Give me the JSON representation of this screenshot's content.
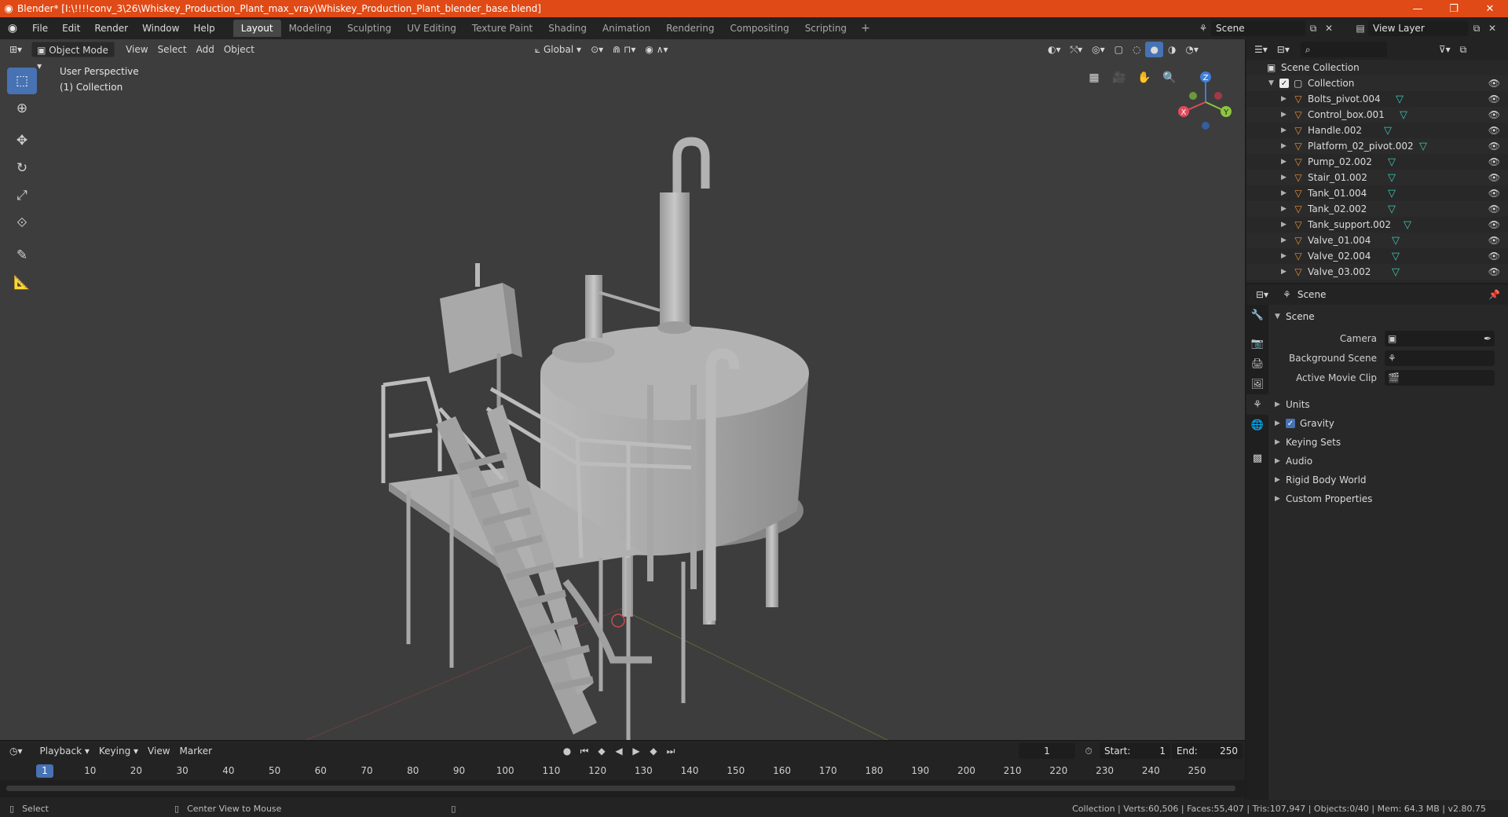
{
  "window": {
    "title": "Blender* [I:\\!!!!conv_3\\26\\Whiskey_Production_Plant_max_vray\\Whiskey_Production_Plant_blender_base.blend]",
    "logo": "blender-logo"
  },
  "menu": [
    "File",
    "Edit",
    "Render",
    "Window",
    "Help"
  ],
  "workspaces": [
    "Layout",
    "Modeling",
    "Sculpting",
    "UV Editing",
    "Texture Paint",
    "Shading",
    "Animation",
    "Rendering",
    "Compositing",
    "Scripting"
  ],
  "workspace_add": "+",
  "scene_selector": {
    "value": "Scene"
  },
  "view_layer_selector": {
    "value": "View Layer"
  },
  "viewport_header": {
    "mode": "Object Mode",
    "menus": [
      "View",
      "Select",
      "Add",
      "Object"
    ],
    "transform_orientation": "Global"
  },
  "viewport": {
    "perspective": "User Perspective",
    "collection": "(1) Collection"
  },
  "gizmo": {
    "z": "Z",
    "x": "X",
    "y": "Y"
  },
  "timeline": {
    "menus": [
      "Playback",
      "Keying",
      "View",
      "Marker"
    ],
    "current_frame": "1",
    "start_label": "Start:",
    "start": "1",
    "end_label": "End:",
    "end": "250",
    "ticks": [
      "10",
      "20",
      "30",
      "40",
      "50",
      "60",
      "70",
      "80",
      "90",
      "100",
      "110",
      "120",
      "130",
      "140",
      "150",
      "160",
      "170",
      "180",
      "190",
      "200",
      "210",
      "220",
      "230",
      "240",
      "250"
    ],
    "marker_frame": "1"
  },
  "statusbar": {
    "left": "Select",
    "middle": "Center View to Mouse",
    "right": "Collection | Verts:60,506 | Faces:55,407 | Tris:107,947 | Objects:0/40 | Mem: 64.3 MB | v2.80.75"
  },
  "outliner": {
    "root": "Scene Collection",
    "collection": "Collection",
    "items": [
      "Bolts_pivot.004",
      "Control_box.001",
      "Handle.002",
      "Platform_02_pivot.002",
      "Pump_02.002",
      "Stair_01.002",
      "Tank_01.004",
      "Tank_02.002",
      "Tank_support.002",
      "Valve_01.004",
      "Valve_02.004",
      "Valve_03.002"
    ]
  },
  "properties": {
    "context": "Scene",
    "panel": "Scene",
    "fields": [
      {
        "label": "Camera",
        "value": ""
      },
      {
        "label": "Background Scene",
        "value": ""
      },
      {
        "label": "Active Movie Clip",
        "value": ""
      }
    ],
    "subpanels": [
      "Units",
      "Gravity",
      "Keying Sets",
      "Audio",
      "Rigid Body World",
      "Custom Properties"
    ],
    "gravity_checked": true
  },
  "colors": {
    "titlebar": "#e04a16",
    "accent": "#4772b3",
    "viewport_bg": "#3d3d3d",
    "mesh_icon": "#e8903a",
    "data_icon": "#40c8b4",
    "axis_x": "#e04a5a",
    "axis_y": "#8cc63f",
    "axis_z": "#3f7fd8"
  }
}
